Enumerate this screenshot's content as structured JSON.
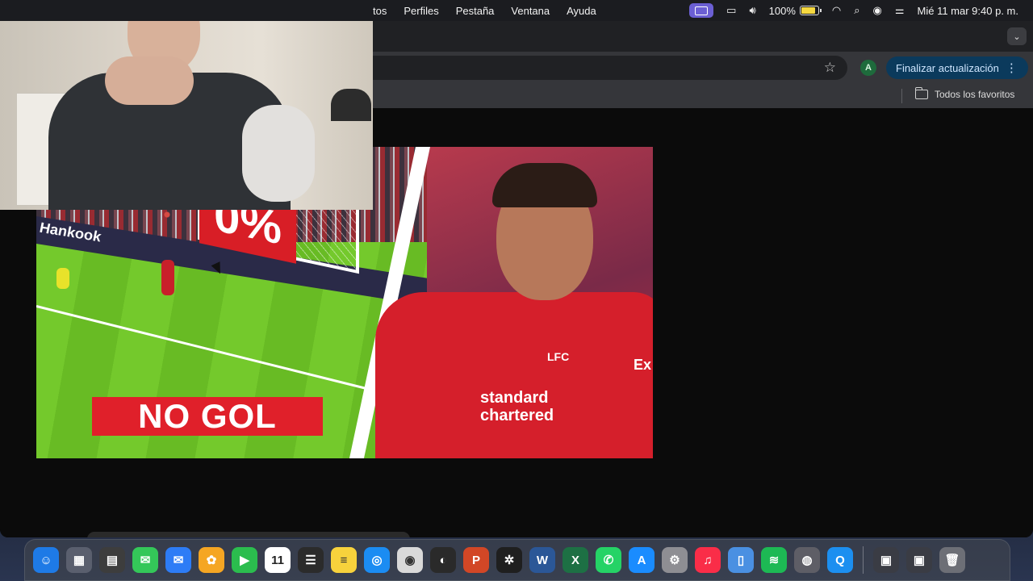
{
  "menubar": {
    "menus": [
      "tos",
      "Perfiles",
      "Pestaña",
      "Ventana",
      "Ayuda"
    ],
    "battery_percent": "100%",
    "datetime": "Mié 11 mar  9:40 p. m."
  },
  "browser": {
    "update_button": "Finalizar actualización",
    "profile_initial": "A",
    "bookmarks_all": "Todos los favoritos"
  },
  "thumbnail": {
    "percent_text": "0%",
    "headline": "NO GOL",
    "adboard_text": "Hankook",
    "sponsor_line1": "standard",
    "sponsor_line2": "chartered",
    "crest_text": "LFC",
    "sleeve_text": "Ex"
  },
  "dock": {
    "calendar_day": "11",
    "apps": [
      {
        "name": "finder-icon",
        "color": "#1e7ae6",
        "glyph": "☺"
      },
      {
        "name": "launchpad-icon",
        "color": "#5a5f6e",
        "glyph": "▦"
      },
      {
        "name": "calculator-icon",
        "color": "#3d3d3d",
        "glyph": "▤"
      },
      {
        "name": "messages-icon",
        "color": "#34c759",
        "glyph": "✉"
      },
      {
        "name": "mail-icon",
        "color": "#2d7cf6",
        "glyph": "✉"
      },
      {
        "name": "photos-icon",
        "color": "#f5a623",
        "glyph": "✿"
      },
      {
        "name": "facetime-icon",
        "color": "#2bbd4e",
        "glyph": "▶"
      },
      {
        "name": "calendar-icon",
        "color": "#ffffff",
        "glyph": "11"
      },
      {
        "name": "reminders-icon",
        "color": "#2b2b2b",
        "glyph": "☰"
      },
      {
        "name": "notes-icon",
        "color": "#f7d23c",
        "glyph": "≡"
      },
      {
        "name": "safari-icon",
        "color": "#1b8cf2",
        "glyph": "◎"
      },
      {
        "name": "chrome-icon",
        "color": "#d9d9d9",
        "glyph": "◉"
      },
      {
        "name": "obs-icon",
        "color": "#2a2a2a",
        "glyph": "◐"
      },
      {
        "name": "powerpoint-icon",
        "color": "#d24726",
        "glyph": "P"
      },
      {
        "name": "chatgpt-icon",
        "color": "#1f1f1f",
        "glyph": "✲"
      },
      {
        "name": "word-icon",
        "color": "#2b5797",
        "glyph": "W"
      },
      {
        "name": "excel-icon",
        "color": "#1d7044",
        "glyph": "X"
      },
      {
        "name": "whatsapp-icon",
        "color": "#25d366",
        "glyph": "✆"
      },
      {
        "name": "app-store-icon",
        "color": "#1a8cff",
        "glyph": "A"
      },
      {
        "name": "system-settings-icon",
        "color": "#8e8e93",
        "glyph": "⚙"
      },
      {
        "name": "music-icon",
        "color": "#fa2d48",
        "glyph": "♫"
      },
      {
        "name": "preview-icon",
        "color": "#4a90e2",
        "glyph": "▯"
      },
      {
        "name": "spotify-icon",
        "color": "#1db954",
        "glyph": "≋"
      },
      {
        "name": "disk-utility-icon",
        "color": "#5e5e66",
        "glyph": "◍"
      },
      {
        "name": "quicktime-icon",
        "color": "#1c8ff0",
        "glyph": "Q"
      }
    ]
  }
}
